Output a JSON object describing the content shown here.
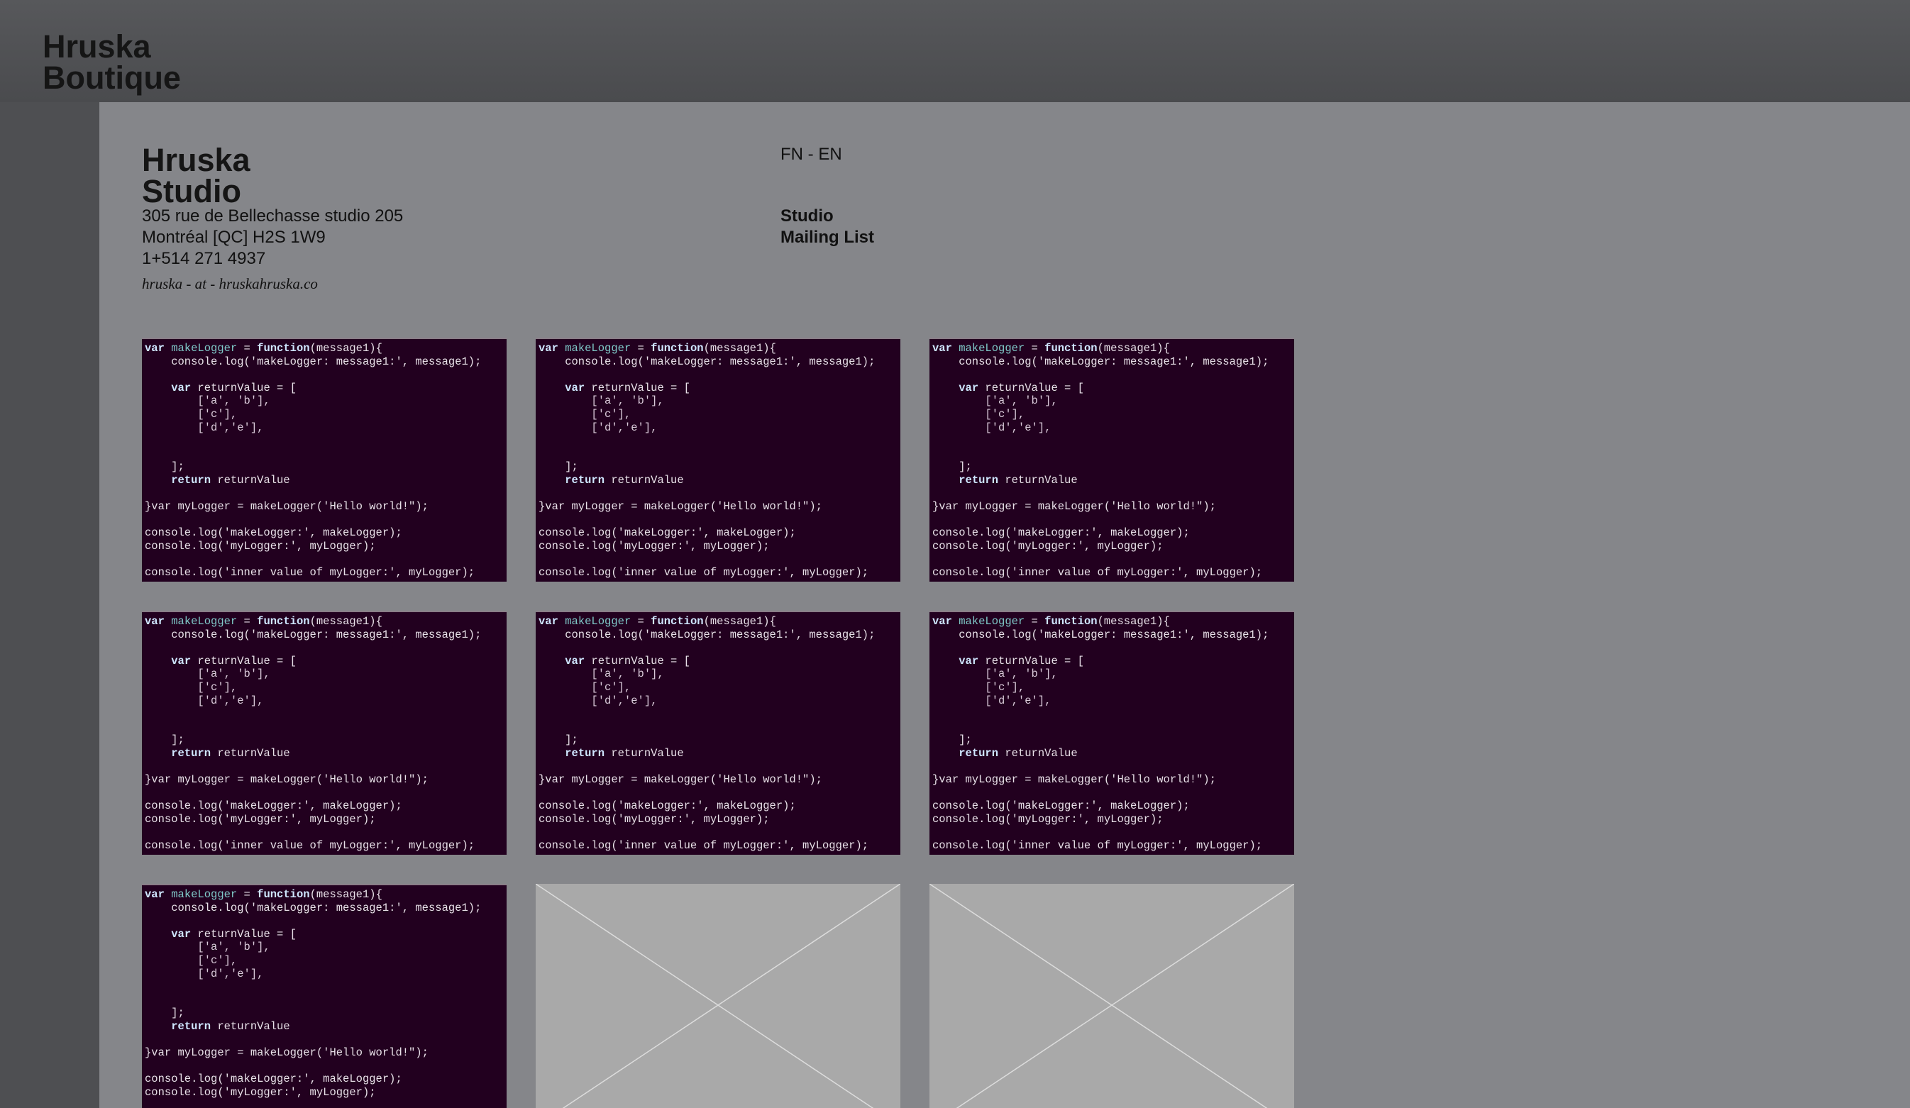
{
  "site": {
    "brand_line1": "Hruska",
    "brand_line2": "Boutique"
  },
  "studio": {
    "title_line1": "Hruska",
    "title_line2": "Studio",
    "address_line1": "305 rue de Bellechasse studio 205",
    "address_line2": "Montréal [QC] H2S 1W9",
    "phone": "1+514 271 4937",
    "email": "hruska - at - hruskahruska.co"
  },
  "language": {
    "fr_label": "FN",
    "separator": " - ",
    "en_label": "EN"
  },
  "nav": {
    "studio_label": "Studio",
    "mailing_label": "Mailing List"
  },
  "code_snippet": {
    "l1a": "var ",
    "l1b": "makeLogger",
    "l1c": " = ",
    "l1d": "function",
    "l1e": "(message1){",
    "l2": "    console.log('makeLogger: message1:', message1);",
    "l3": "",
    "l4a": "    ",
    "l4b": "var",
    "l4c": " returnValue = [",
    "l5": "        ['a', 'b'],",
    "l6": "        ['c'],",
    "l7": "        ['d','e'],",
    "l8": "",
    "l9": "",
    "l10": "    ];",
    "l11a": "    ",
    "l11b": "return",
    "l11c": " returnValue",
    "l12": "",
    "l13": "}var myLogger = makeLogger('Hello world!\");",
    "l14": "",
    "l15": "console.log('makeLogger:', makeLogger);",
    "l16": "console.log('myLogger:', myLogger);",
    "l17": "",
    "l18": "console.log('inner value of myLogger:', myLogger);"
  },
  "colors": {
    "code_bg": "#22001f",
    "panel_bg": "#85868a",
    "placeholder_bg": "#a9a9a9"
  },
  "icons": {
    "placeholder": "image-placeholder-icon"
  }
}
